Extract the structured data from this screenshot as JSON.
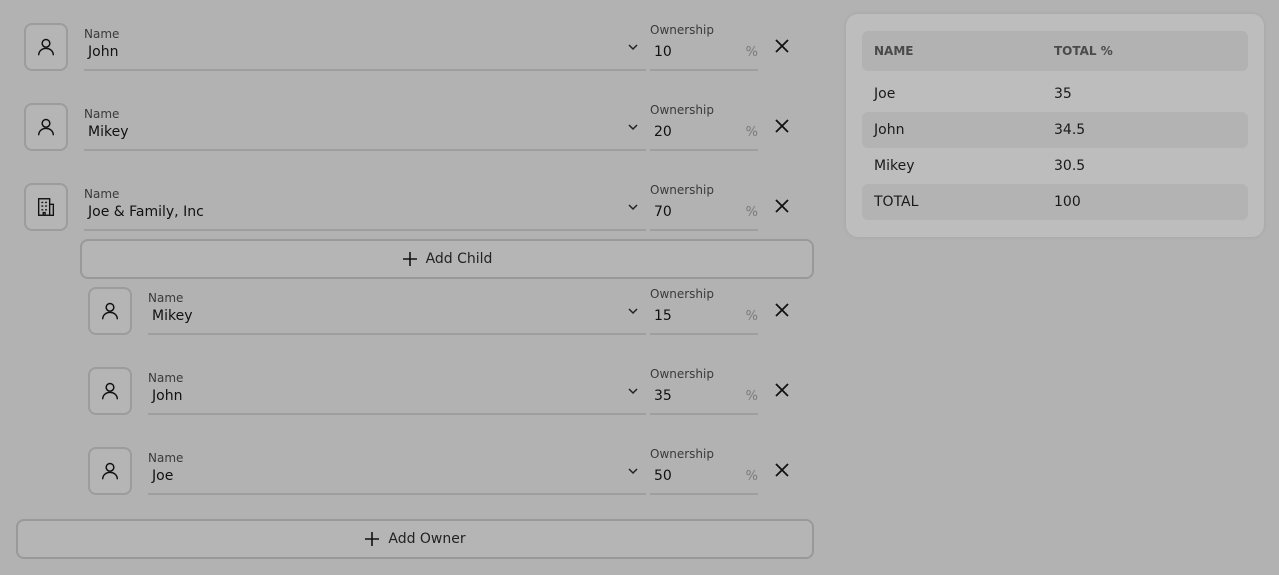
{
  "owners": [
    {
      "name_label": "Name",
      "name": "John",
      "own_label": "Ownership",
      "own": "10",
      "pct": "%",
      "icon": "person-icon"
    },
    {
      "name_label": "Name",
      "name": "Mikey",
      "own_label": "Ownership",
      "own": "20",
      "pct": "%",
      "icon": "person-icon"
    },
    {
      "name_label": "Name",
      "name": "Joe & Family, Inc",
      "own_label": "Ownership",
      "own": "70",
      "pct": "%",
      "icon": "building-icon"
    }
  ],
  "children": [
    {
      "name_label": "Name",
      "name": "Mikey",
      "own_label": "Ownership",
      "own": "15",
      "pct": "%",
      "icon": "person-icon"
    },
    {
      "name_label": "Name",
      "name": "John",
      "own_label": "Ownership",
      "own": "35",
      "pct": "%",
      "icon": "person-icon"
    },
    {
      "name_label": "Name",
      "name": "Joe",
      "own_label": "Ownership",
      "own": "50",
      "pct": "%",
      "icon": "person-icon"
    }
  ],
  "add_child_label": "Add Child",
  "add_owner_label": "Add Owner",
  "summary": {
    "headers": [
      "NAME",
      "TOTAL %"
    ],
    "rows": [
      {
        "name": "Joe",
        "total": "35"
      },
      {
        "name": "John",
        "total": "34.5"
      },
      {
        "name": "Mikey",
        "total": "30.5"
      },
      {
        "name": "TOTAL",
        "total": "100"
      }
    ]
  }
}
